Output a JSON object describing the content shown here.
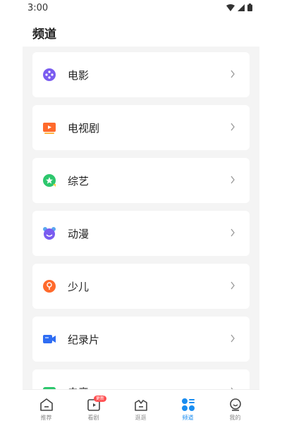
{
  "status": {
    "time": "3:00"
  },
  "header": {
    "title": "频道"
  },
  "channels": [
    {
      "label": "电影",
      "icon": "movie-icon"
    },
    {
      "label": "电视剧",
      "icon": "tv-series-icon"
    },
    {
      "label": "综艺",
      "icon": "variety-icon"
    },
    {
      "label": "动漫",
      "icon": "anime-icon"
    },
    {
      "label": "少儿",
      "icon": "kids-icon"
    },
    {
      "label": "纪录片",
      "icon": "documentary-icon"
    },
    {
      "label": "电竞",
      "icon": "esports-icon"
    }
  ],
  "tabs": [
    {
      "label": "推荐",
      "icon": "home-icon"
    },
    {
      "label": "看剧",
      "icon": "play-icon",
      "badge": "更新"
    },
    {
      "label": "逛逛",
      "icon": "browse-icon"
    },
    {
      "label": "频道",
      "icon": "channels-icon"
    },
    {
      "label": "我的",
      "icon": "profile-icon"
    }
  ],
  "colors": {
    "accent": "#1a8df0",
    "badge": "#ff4d4f"
  }
}
